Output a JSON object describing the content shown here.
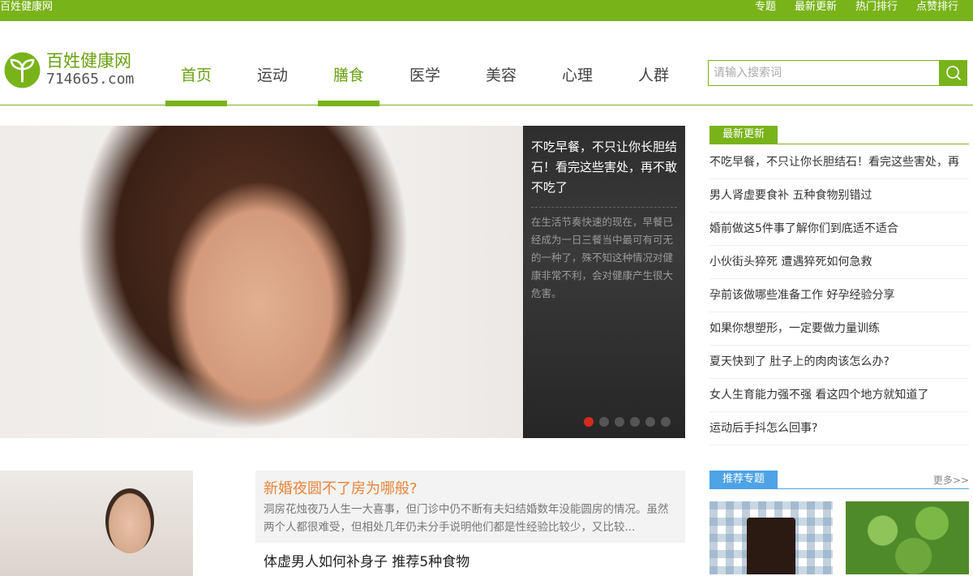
{
  "topbar": {
    "site_name": "百姓健康网",
    "links": [
      "专题",
      "最新更新",
      "热门排行",
      "点赞排行"
    ]
  },
  "logo": {
    "name": "百姓健康网",
    "domain": "714665.com"
  },
  "nav": {
    "items": [
      "首页",
      "运动",
      "膳食",
      "医学",
      "美容",
      "心理",
      "人群"
    ],
    "active": [
      "首页",
      "膳食"
    ]
  },
  "search": {
    "placeholder": "请输入搜索词"
  },
  "slider": {
    "title": "不吃早餐，不只让你长胆结石！看完这些害处，再不敢不吃了",
    "description": "在生活节奏快速的现在，早餐已经成为一日三餐当中最可有可无的一种了，殊不知这种情况对健康非常不利，会对健康产生很大危害。",
    "dot_count": 6,
    "active_dot": 1
  },
  "latest": {
    "heading": "最新更新",
    "items": [
      "不吃早餐，不只让你长胆结石！看完这些害处，再",
      "男人肾虚要食补 五种食物别错过",
      "婚前做这5件事了解你们到底适不适合",
      "小伙街头猝死 遭遇猝死如何急救",
      "孕前该做哪些准备工作 好孕经验分享",
      "如果你想塑形，一定要做力量训练",
      "夏天快到了 肚子上的肉肉该怎么办?",
      "女人生育能力强不强 看这四个地方就知道了",
      "运动后手抖怎么回事?"
    ]
  },
  "feature": {
    "title": "新婚夜圆不了房为哪般?",
    "description": "洞房花烛夜乃人生一大喜事，但门诊中仍不断有夫妇结婚数年没能圆房的情况。虽然两个人都很难受，但相处几年仍未分手说明他们都是性经验比较少，又比较..."
  },
  "article2": {
    "title": "体虚男人如何补身子 推荐5种食物"
  },
  "topics": {
    "heading": "推荐专题",
    "more": "更多>>"
  },
  "colors": {
    "brand_green": "#79b31a",
    "topic_blue": "#4da3e6",
    "feature_orange": "#e8843a",
    "active_dot_red": "#d42b1e"
  }
}
